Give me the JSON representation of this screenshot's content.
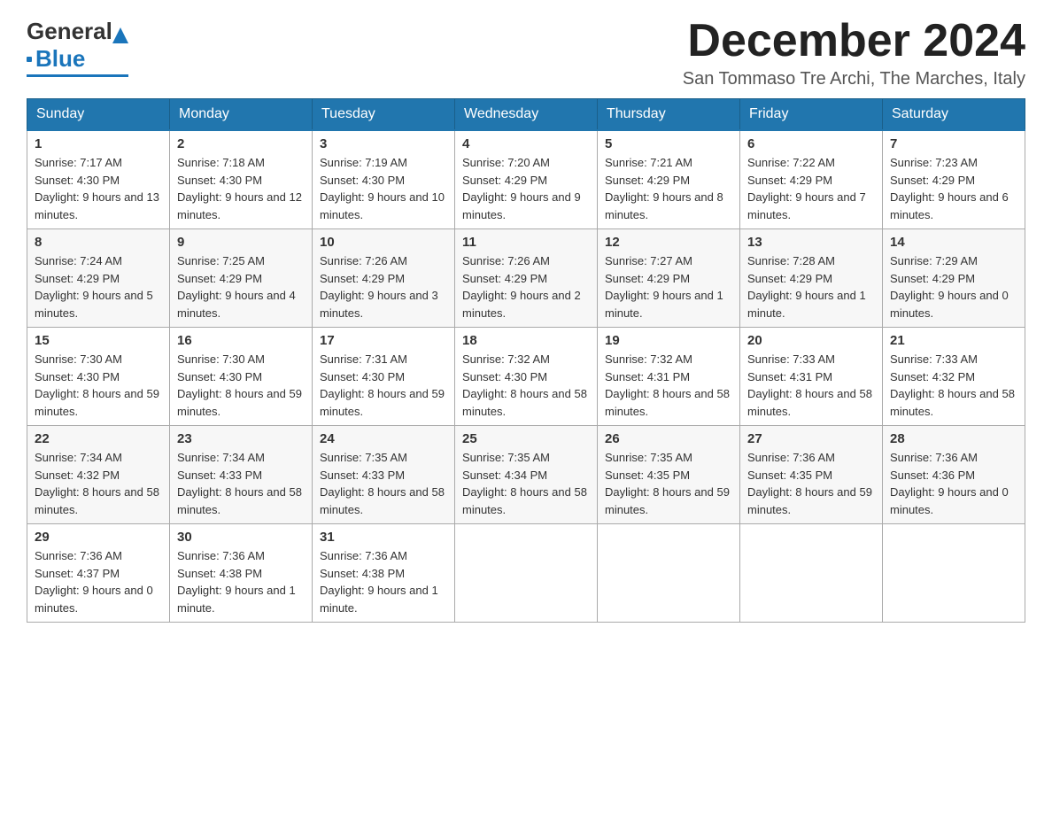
{
  "logo": {
    "general": "General",
    "blue": "Blue"
  },
  "title": {
    "month": "December 2024",
    "location": "San Tommaso Tre Archi, The Marches, Italy"
  },
  "weekdays": [
    "Sunday",
    "Monday",
    "Tuesday",
    "Wednesday",
    "Thursday",
    "Friday",
    "Saturday"
  ],
  "weeks": [
    [
      {
        "day": "1",
        "sunrise": "7:17 AM",
        "sunset": "4:30 PM",
        "daylight": "9 hours and 13 minutes."
      },
      {
        "day": "2",
        "sunrise": "7:18 AM",
        "sunset": "4:30 PM",
        "daylight": "9 hours and 12 minutes."
      },
      {
        "day": "3",
        "sunrise": "7:19 AM",
        "sunset": "4:30 PM",
        "daylight": "9 hours and 10 minutes."
      },
      {
        "day": "4",
        "sunrise": "7:20 AM",
        "sunset": "4:29 PM",
        "daylight": "9 hours and 9 minutes."
      },
      {
        "day": "5",
        "sunrise": "7:21 AM",
        "sunset": "4:29 PM",
        "daylight": "9 hours and 8 minutes."
      },
      {
        "day": "6",
        "sunrise": "7:22 AM",
        "sunset": "4:29 PM",
        "daylight": "9 hours and 7 minutes."
      },
      {
        "day": "7",
        "sunrise": "7:23 AM",
        "sunset": "4:29 PM",
        "daylight": "9 hours and 6 minutes."
      }
    ],
    [
      {
        "day": "8",
        "sunrise": "7:24 AM",
        "sunset": "4:29 PM",
        "daylight": "9 hours and 5 minutes."
      },
      {
        "day": "9",
        "sunrise": "7:25 AM",
        "sunset": "4:29 PM",
        "daylight": "9 hours and 4 minutes."
      },
      {
        "day": "10",
        "sunrise": "7:26 AM",
        "sunset": "4:29 PM",
        "daylight": "9 hours and 3 minutes."
      },
      {
        "day": "11",
        "sunrise": "7:26 AM",
        "sunset": "4:29 PM",
        "daylight": "9 hours and 2 minutes."
      },
      {
        "day": "12",
        "sunrise": "7:27 AM",
        "sunset": "4:29 PM",
        "daylight": "9 hours and 1 minute."
      },
      {
        "day": "13",
        "sunrise": "7:28 AM",
        "sunset": "4:29 PM",
        "daylight": "9 hours and 1 minute."
      },
      {
        "day": "14",
        "sunrise": "7:29 AM",
        "sunset": "4:29 PM",
        "daylight": "9 hours and 0 minutes."
      }
    ],
    [
      {
        "day": "15",
        "sunrise": "7:30 AM",
        "sunset": "4:30 PM",
        "daylight": "8 hours and 59 minutes."
      },
      {
        "day": "16",
        "sunrise": "7:30 AM",
        "sunset": "4:30 PM",
        "daylight": "8 hours and 59 minutes."
      },
      {
        "day": "17",
        "sunrise": "7:31 AM",
        "sunset": "4:30 PM",
        "daylight": "8 hours and 59 minutes."
      },
      {
        "day": "18",
        "sunrise": "7:32 AM",
        "sunset": "4:30 PM",
        "daylight": "8 hours and 58 minutes."
      },
      {
        "day": "19",
        "sunrise": "7:32 AM",
        "sunset": "4:31 PM",
        "daylight": "8 hours and 58 minutes."
      },
      {
        "day": "20",
        "sunrise": "7:33 AM",
        "sunset": "4:31 PM",
        "daylight": "8 hours and 58 minutes."
      },
      {
        "day": "21",
        "sunrise": "7:33 AM",
        "sunset": "4:32 PM",
        "daylight": "8 hours and 58 minutes."
      }
    ],
    [
      {
        "day": "22",
        "sunrise": "7:34 AM",
        "sunset": "4:32 PM",
        "daylight": "8 hours and 58 minutes."
      },
      {
        "day": "23",
        "sunrise": "7:34 AM",
        "sunset": "4:33 PM",
        "daylight": "8 hours and 58 minutes."
      },
      {
        "day": "24",
        "sunrise": "7:35 AM",
        "sunset": "4:33 PM",
        "daylight": "8 hours and 58 minutes."
      },
      {
        "day": "25",
        "sunrise": "7:35 AM",
        "sunset": "4:34 PM",
        "daylight": "8 hours and 58 minutes."
      },
      {
        "day": "26",
        "sunrise": "7:35 AM",
        "sunset": "4:35 PM",
        "daylight": "8 hours and 59 minutes."
      },
      {
        "day": "27",
        "sunrise": "7:36 AM",
        "sunset": "4:35 PM",
        "daylight": "8 hours and 59 minutes."
      },
      {
        "day": "28",
        "sunrise": "7:36 AM",
        "sunset": "4:36 PM",
        "daylight": "9 hours and 0 minutes."
      }
    ],
    [
      {
        "day": "29",
        "sunrise": "7:36 AM",
        "sunset": "4:37 PM",
        "daylight": "9 hours and 0 minutes."
      },
      {
        "day": "30",
        "sunrise": "7:36 AM",
        "sunset": "4:38 PM",
        "daylight": "9 hours and 1 minute."
      },
      {
        "day": "31",
        "sunrise": "7:36 AM",
        "sunset": "4:38 PM",
        "daylight": "9 hours and 1 minute."
      },
      null,
      null,
      null,
      null
    ]
  ]
}
